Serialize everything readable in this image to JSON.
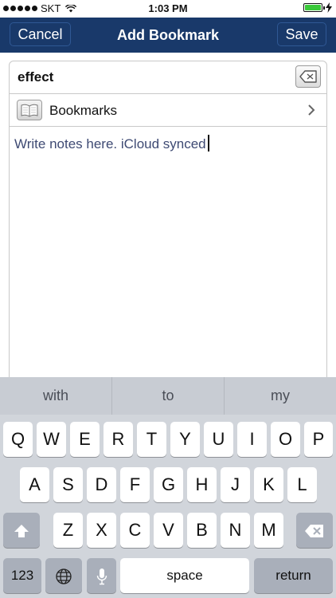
{
  "status_bar": {
    "carrier": "SKT",
    "time": "1:03 PM"
  },
  "nav": {
    "cancel_label": "Cancel",
    "title": "Add Bookmark",
    "save_label": "Save"
  },
  "form": {
    "title_value": "effect",
    "folder_label": "Bookmarks",
    "notes_text": "Write notes here. iCloud synced"
  },
  "keyboard": {
    "suggestions": [
      "with",
      "to",
      "my"
    ],
    "row1": [
      "Q",
      "W",
      "E",
      "R",
      "T",
      "Y",
      "U",
      "I",
      "O",
      "P"
    ],
    "row2": [
      "A",
      "S",
      "D",
      "F",
      "G",
      "H",
      "J",
      "K",
      "L"
    ],
    "row3": [
      "Z",
      "X",
      "C",
      "V",
      "B",
      "N",
      "M"
    ],
    "numbers_label": "123",
    "space_label": "space",
    "return_label": "return"
  },
  "colors": {
    "nav_bar": "#19396a",
    "notes_text": "#3e4a73",
    "keyboard_bg": "#d1d5db",
    "battery": "#3ac93a"
  },
  "icons": [
    "wifi-icon",
    "battery-icon",
    "clear-text-icon",
    "book-icon",
    "chevron-right-icon",
    "shift-icon",
    "globe-icon",
    "microphone-icon",
    "delete-icon"
  ]
}
